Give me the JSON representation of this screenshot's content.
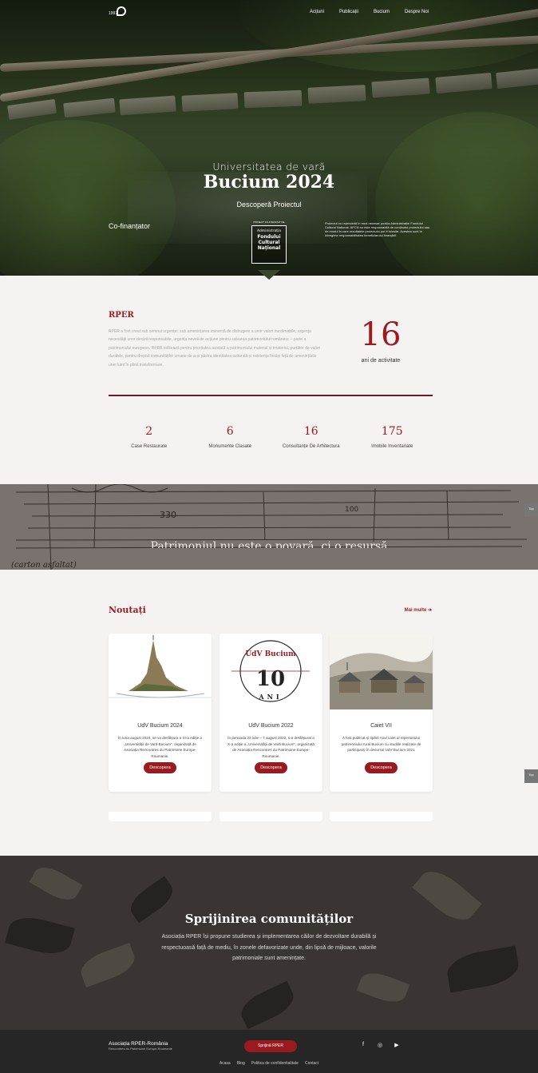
{
  "header": {
    "logo_year": "1997",
    "nav": [
      "Acțiuni",
      "Publicații",
      "Bucium",
      "Despre Noi"
    ]
  },
  "hero": {
    "subtitle": "Universitatea de vară",
    "title": "Bucium 2024",
    "cta": "Descoperă Proiectul",
    "cofin_label": "Co-finanțator",
    "afcn_caption": "PROIECT CO-FINANȚAT DE",
    "afcn_line1": "Administrația",
    "afcn_line2": "Fondului",
    "afcn_line3": "Cultural",
    "afcn_line4": "Național",
    "disclaimer": "Proiectul nu reprezintă în mod necesar poziția Administrației Fondului Cultural Național. AFCN nu este responsabilă de conținutul proiectului sau de modul în care rezultatele proiectului pot fi folosite. Acestea sunt în întregime responsabilitatea beneficiarului finanțării."
  },
  "rper": {
    "title": "RPER",
    "text": "RPER a fost creat sub semnul urgenței: sub amenințarea iminentă de distrugere a unor valori inestimabile, urgența necesității unor decizii responsabile, urgența nevoii de acțiune pentru salvarea patrimoniului românesc – parte a patrimoniului european. RPER militează pentru prioritatea asistată a patrimoniului material și imaterial, purtător de valori durabile, pentru dreptul comunităților umane de a-și păstra identitatea culturală și existența însăși față de amenințările unei lumi în plină transformare.",
    "years": "16",
    "years_label": "ani de activitate"
  },
  "stats": [
    {
      "value": "2",
      "label": "Case Restaurate"
    },
    {
      "value": "6",
      "label": "Monumente Clasate"
    },
    {
      "value": "16",
      "label": "Consultanțe De Arhitectura"
    },
    {
      "value": "175",
      "label": "Imobile Inventariate"
    }
  ],
  "band": {
    "text": "Patrimoniul nu este o povară, ci o resursă",
    "sketch_label_1": "330",
    "sketch_label_2": "100",
    "sketch_label_3": "(carton asfaltat)"
  },
  "side_buttons": [
    "Top",
    "Top",
    "Top"
  ],
  "news": {
    "title": "Noutați",
    "more": "Mai multe ➔",
    "cards": [
      {
        "title": "UdV Bucium 2024",
        "desc": "În luna august 2024, se va desfășura a XI-a ediție a „Universității de Vară Bucium”, organizată de Asociația Rencontres du Patrimoine Europe-Roumanie.",
        "button": "Descopera"
      },
      {
        "title": "UdV Bucium 2022",
        "desc": "În perioada 23 iulie – 7 august 2022, s-a desfășurat a X-a ediție a „Universității de Vară Bucium”, organizată de Asociația Rencontres du Patrimoine Europe-Roumanie.",
        "button": "Descopera",
        "logo_text": "UdV Bucium",
        "logo_ani": "ANI",
        "logo_num": "10"
      },
      {
        "title": "Caiet VII",
        "desc": "A fost publicat și tipărit noul caiet al repertoriului patrimoniului rural Bucium cu studiile realizate de participanți în decursul UdV Bucium 2021",
        "button": "Descopera"
      }
    ]
  },
  "support": {
    "title": "Sprijinirea comunităților",
    "text": "Asociația RPER își propune studierea și implementarea căilor de dezvoltare durabilă și respectuoasă față de mediu, în zonele defavorizate unde, din lipsă de mijloace, valorile patrimoniale sunt amenințate."
  },
  "footer": {
    "org": "Asociația RPER-România",
    "org_sub": "Rencontres du Patrimoine Europe-Roumanie",
    "button": "Sprijină RPER",
    "social": [
      "f",
      "◎",
      "▶"
    ],
    "links": [
      "Acasa",
      "Blog",
      "Politica de confidentialitate",
      "Contact"
    ]
  },
  "colors": {
    "accent": "#9a1b1f",
    "footer_bg": "#262626",
    "page_bg": "#f4f3f1"
  }
}
